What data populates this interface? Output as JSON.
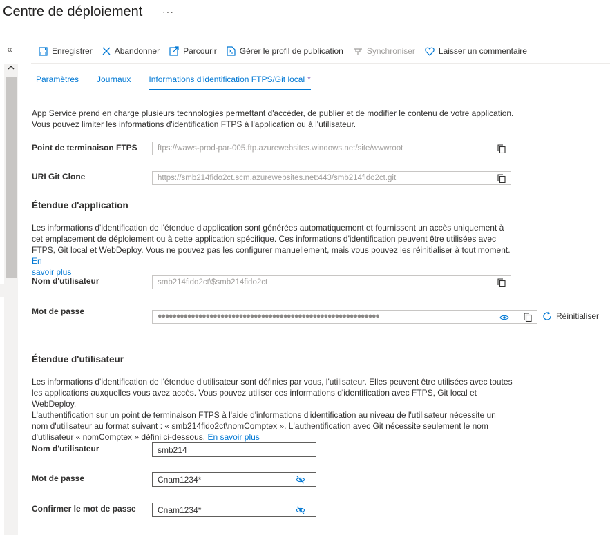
{
  "page": {
    "title": "Centre de déploiement",
    "more": "···"
  },
  "toolbar": {
    "collapse": "«",
    "save": "Enregistrer",
    "discard": "Abandonner",
    "browse": "Parcourir",
    "publish_profile": "Gérer le profil de publication",
    "sync": "Synchroniser",
    "feedback": "Laisser un commentaire"
  },
  "tabs": [
    {
      "label": "Paramètres"
    },
    {
      "label": "Journaux"
    },
    {
      "label": "Informations d'identification FTPS/Git local",
      "modified": "*"
    }
  ],
  "intro": {
    "line1": "App Service prend en charge plusieurs technologies permettant d'accéder, de publier et de modifier le contenu de votre application.",
    "line2": "Vous pouvez limiter les informations d'identification FTPS à l'application ou à l'utilisateur."
  },
  "endpoints": {
    "ftps_label": "Point de terminaison FTPS",
    "ftps_value": "ftps://waws-prod-par-005.ftp.azurewebsites.windows.net/site/wwwroot",
    "git_label": "URI Git Clone",
    "git_value": "https://smb214fido2ct.scm.azurewebsites.net:443/smb214fido2ct.git"
  },
  "app_scope": {
    "heading": "Étendue d'application",
    "desc_line1": "Les informations d'identification de l'étendue d'application sont générées automatiquement et fournissent un accès uniquement à",
    "desc_line2": "cet emplacement de déploiement ou à cette application spécifique. Ces informations d'identification peuvent être utilisées avec",
    "desc_line3": "FTPS, Git local et WebDeploy. Vous ne pouvez pas les configurer manuellement, mais vous pouvez les réinitialiser à tout moment.",
    "link_part1": "En",
    "link_part2": "savoir plus",
    "username_label": "Nom d'utilisateur",
    "username_value": "smb214fido2ct\\$smb214fido2ct",
    "password_label": "Mot de passe",
    "password_mask": "●●●●●●●●●●●●●●●●●●●●●●●●●●●●●●●●●●●●●●●●●●●●●●●●●●●●●●●●●●●●",
    "reset_label": "Réinitialiser"
  },
  "user_scope": {
    "heading": "Étendue d'utilisateur",
    "desc_line1": "Les informations d'identification de l'étendue d'utilisateur sont définies par vous, l'utilisateur. Elles peuvent être utilisées avec toutes",
    "desc_line2": "les applications auxquelles vous avez accès. Vous pouvez utiliser ces informations d'identification avec FTPS, Git local et WebDeploy.",
    "desc_line3": "L'authentification sur un point de terminaison FTPS à l'aide d'informations d'identification au niveau de l'utilisateur nécessite un",
    "desc_line4": "nom d'utilisateur au format suivant : « smb214fido2ct\\nomComptex ». L'authentification avec Git nécessite seulement le nom",
    "desc_line5": "d'utilisateur « nomComptex » défini ci-dessous.",
    "link": "En savoir plus",
    "username_label": "Nom d'utilisateur",
    "username_value": "smb214",
    "password_label": "Mot de passe",
    "password_value": "Cnam1234*",
    "confirm_label": "Confirmer le mot de passe",
    "confirm_value": "Cnam1234*"
  }
}
